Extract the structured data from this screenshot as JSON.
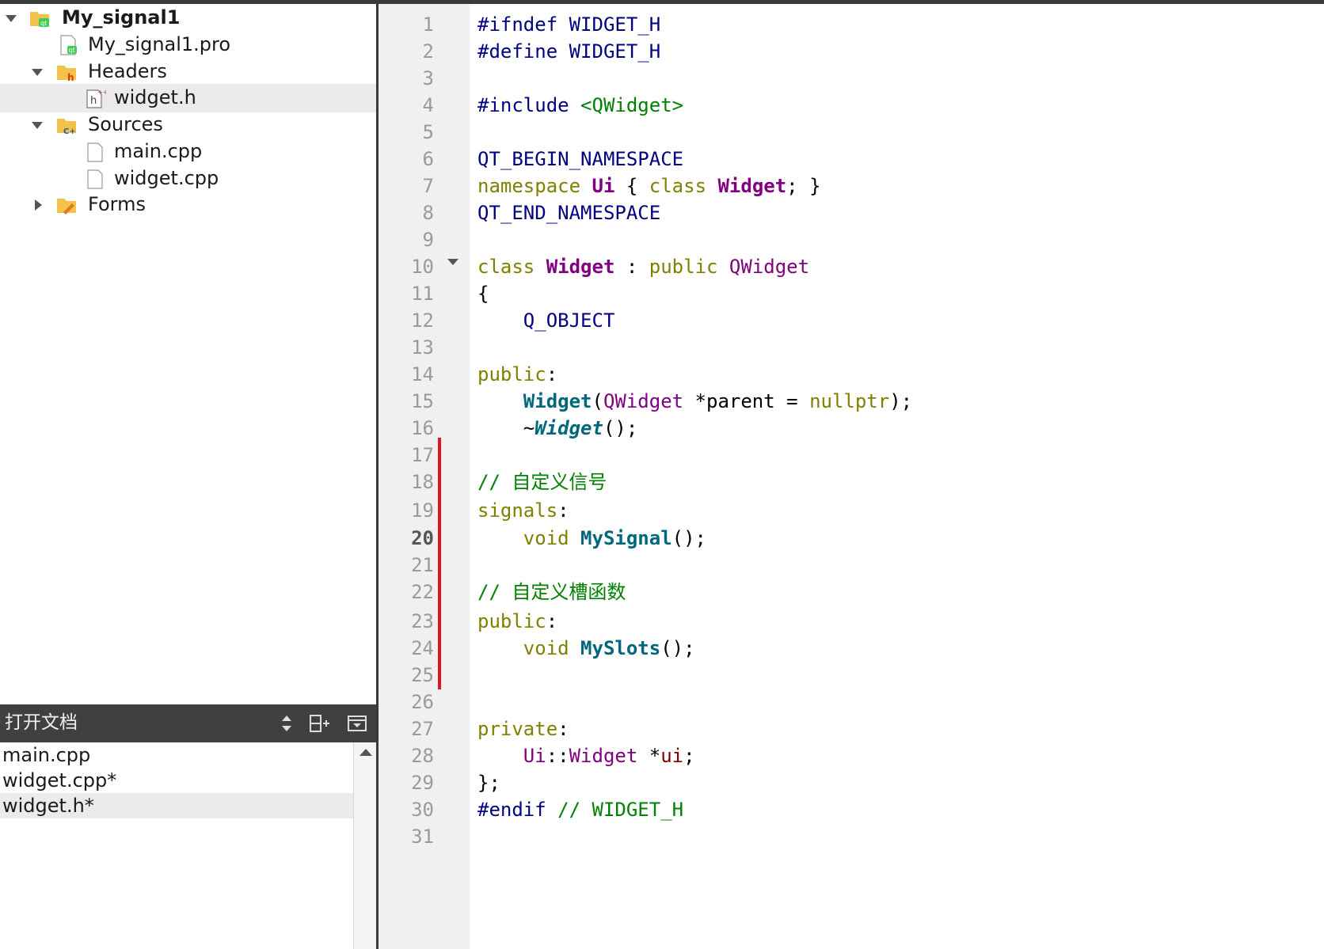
{
  "project_tree": {
    "project_name": "My_signal1",
    "pro_file": "My_signal1.pro",
    "headers_label": "Headers",
    "header_file": "widget.h",
    "sources_label": "Sources",
    "source_file_1": "main.cpp",
    "source_file_2": "widget.cpp",
    "forms_label": "Forms"
  },
  "open_documents": {
    "title": "打开文档",
    "items": [
      "main.cpp",
      "widget.cpp*",
      "widget.h*"
    ],
    "selected_item": "widget.h*"
  },
  "editor": {
    "current_line": 20,
    "line_numbers": [
      "1",
      "2",
      "3",
      "4",
      "5",
      "6",
      "7",
      "8",
      "9",
      "10",
      "11",
      "12",
      "13",
      "14",
      "15",
      "16",
      "17",
      "18",
      "19",
      "20",
      "21",
      "22",
      "23",
      "24",
      "25",
      "26",
      "27",
      "28",
      "29",
      "30",
      "31"
    ],
    "code": {
      "l1a": "#ifndef",
      "l1b": " WIDGET_H",
      "l2a": "#define",
      "l2b": " WIDGET_H",
      "l4a": "#include",
      "l4b": " <QWidget>",
      "l6": "QT_BEGIN_NAMESPACE",
      "l7a": "namespace",
      "l7b": "Ui",
      "l7c": " { ",
      "l7d": "class",
      "l7e": "Widget",
      "l7f": "; }",
      "l8": "QT_END_NAMESPACE",
      "l10a": "class",
      "l10b": "Widget",
      "l10c": " : ",
      "l10d": "public",
      "l10e": "QWidget",
      "l11": "{",
      "l12": "Q_OBJECT",
      "l14a": "public",
      "l14b": ":",
      "l15a": "Widget",
      "l15b": "(",
      "l15c": "QWidget",
      "l15d": " *parent = ",
      "l15e": "nullptr",
      "l15f": ");",
      "l16a": "~",
      "l16b": "Widget",
      "l16c": "();",
      "l18": "// 自定义信号",
      "l19a": "signals",
      "l19b": ":",
      "l20a": "void",
      "l20b": "MySignal",
      "l20c": "();",
      "l22": "// 自定义槽函数",
      "l23a": "public",
      "l23b": ":",
      "l24a": "void",
      "l24b": "MySlots",
      "l24c": "();",
      "l27a": "private",
      "l27b": ":",
      "l28a": "Ui",
      "l28b": "::",
      "l28c": "Widget",
      "l28d": " *",
      "l28e": "ui",
      "l28f": ";",
      "l29": "};",
      "l30a": "#endif",
      "l30b": " // WIDGET_H"
    }
  }
}
